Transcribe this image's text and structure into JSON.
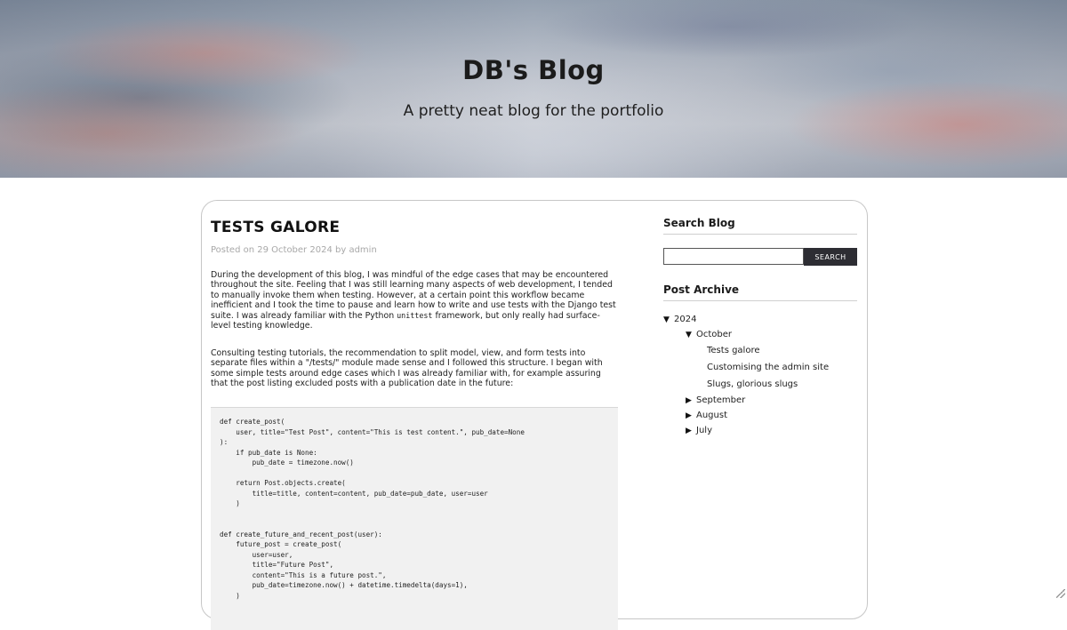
{
  "header": {
    "title": "DB's Blog",
    "tagline": "A pretty neat blog for the portfolio"
  },
  "post": {
    "title": "TESTS GALORE",
    "meta_prefix": "Posted on",
    "date": "29 October 2024",
    "meta_by": "by",
    "author": "admin",
    "para1_a": "During the development of this blog, I was mindful of the edge cases that may be encountered throughout the site. Feeling that I was still learning many aspects of web development, I tended to manually invoke them when testing. However, at a certain point this workflow became inefficient and I took the time to pause and learn how to write and use tests with the Django test suite. I was already familiar with the Python",
    "para1_code": "unittest",
    "para1_b": "framework, but only really had surface-level testing knowledge.",
    "para2": "Consulting testing tutorials, the recommendation to split model, view, and form tests into separate files within a \"/tests/\" module made sense and I followed this structure. I began with some simple tests around edge cases which I was already familiar with, for example assuring that the post listing excluded posts with a publication date in the future:",
    "code": "def create_post(\n    user, title=\"Test Post\", content=\"This is test content.\", pub_date=None\n):\n    if pub_date is None:\n        pub_date = timezone.now()\n\n    return Post.objects.create(\n        title=title, content=content, pub_date=pub_date, user=user\n    )\n\n\ndef create_future_and_recent_post(user):\n    future_post = create_post(\n        user=user,\n        title=\"Future Post\",\n        content=\"This is a future post.\",\n        pub_date=timezone.now() + datetime.timedelta(days=1),\n    )"
  },
  "sidebar": {
    "search_title": "Search Blog",
    "search_placeholder": "",
    "search_button": "SEARCH",
    "archive_title": "Post Archive",
    "archive": {
      "year": "2024",
      "open_month": "October",
      "open_posts": [
        "Tests galore",
        "Customising the admin site",
        "Slugs, glorious slugs"
      ],
      "closed_months": [
        "September",
        "August",
        "July"
      ]
    }
  },
  "icons": {
    "expanded": "triangle-down-icon",
    "collapsed": "triangle-right-icon"
  }
}
